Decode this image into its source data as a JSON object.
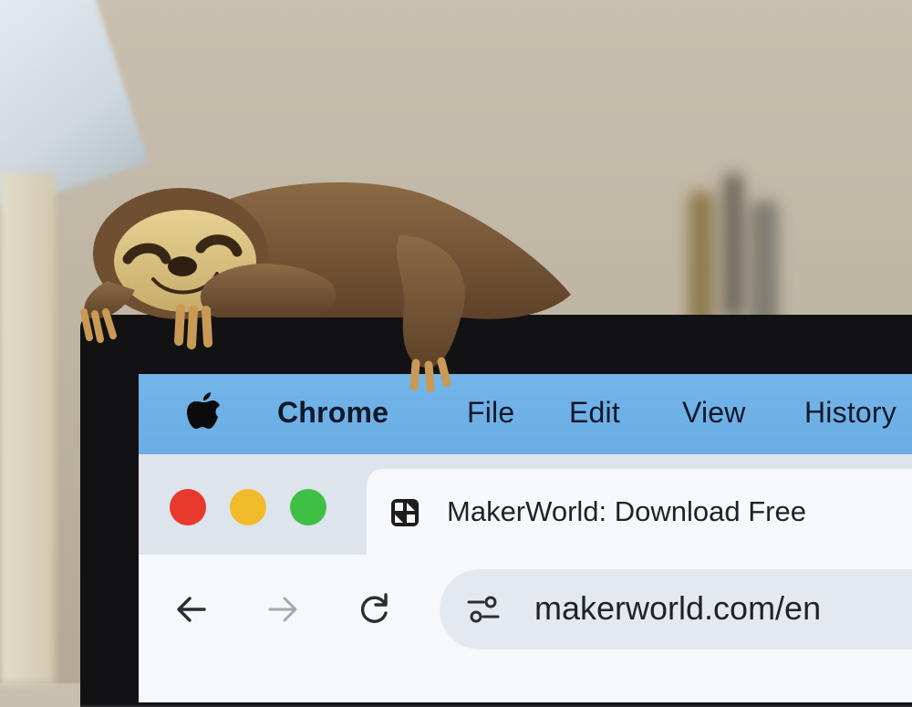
{
  "menubar": {
    "apple_icon": "apple-logo-icon",
    "items": [
      "Chrome",
      "File",
      "Edit",
      "View",
      "History"
    ]
  },
  "window": {
    "traffic_lights": [
      "close",
      "minimize",
      "maximize"
    ],
    "tab": {
      "favicon": "makerworld-favicon-icon",
      "title": "MakerWorld: Download Free"
    },
    "toolbar": {
      "back_icon": "back-arrow-icon",
      "forward_icon": "forward-arrow-icon",
      "reload_icon": "reload-icon",
      "site_info_icon": "tune-icon",
      "url": "makerworld.com/en"
    }
  },
  "colors": {
    "menubar": "#6aaee6",
    "close": "#e8392d",
    "minimize": "#f1bc2c",
    "maximize": "#3fbf44",
    "sloth_fur": "#7a5a3a",
    "sloth_face": "#d9c283"
  }
}
